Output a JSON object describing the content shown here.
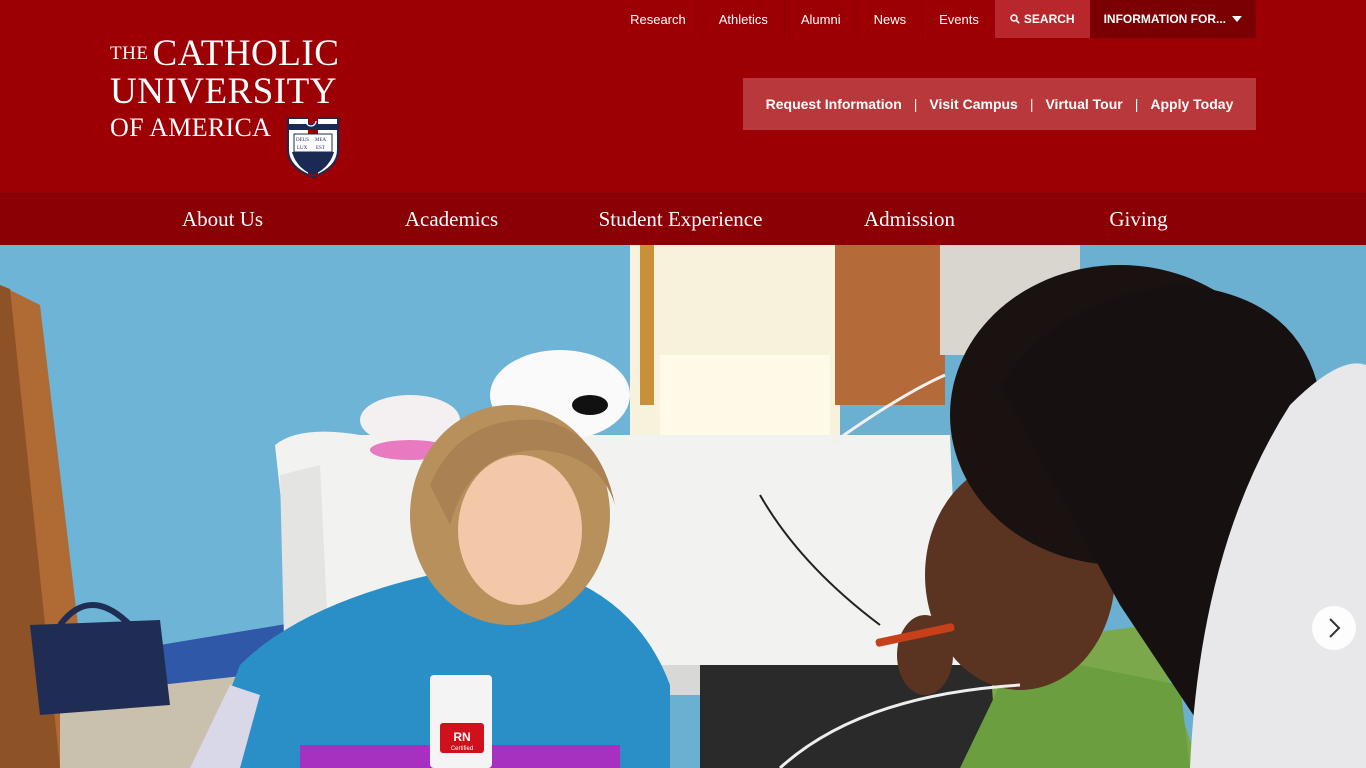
{
  "logo": {
    "the": "THE",
    "line1": "CATHOLIC",
    "line2": "UNIVERSITY",
    "line3": "OF AMERICA",
    "shield_text": [
      "DEUS",
      "MEA",
      "LUX",
      "EST"
    ]
  },
  "utility_nav": {
    "links": [
      "Research",
      "Athletics",
      "Alumni",
      "News",
      "Events"
    ],
    "search_label": "SEARCH",
    "info_label": "INFORMATION FOR..."
  },
  "cta": {
    "links": [
      "Request Information",
      "Visit Campus",
      "Virtual Tour",
      "Apply Today"
    ],
    "separator": "|"
  },
  "main_nav": {
    "items": [
      "About Us",
      "Academics",
      "Student Experience",
      "Admission",
      "Giving"
    ]
  },
  "hero": {
    "badge": "RN",
    "badge_sub": "Certified"
  },
  "colors": {
    "brand_red": "#9c0004",
    "nav_red": "#8a0005",
    "cta_bg": "#b8383b",
    "search_bg": "#b8272b",
    "info_bg": "#7a0003"
  },
  "icons": {
    "search": "search-icon",
    "dropdown": "caret-down-icon",
    "next": "chevron-right-icon"
  }
}
